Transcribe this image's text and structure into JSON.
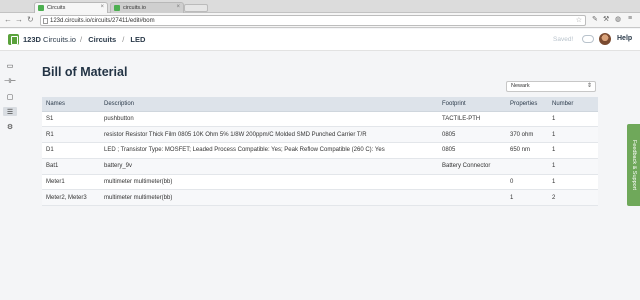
{
  "browser": {
    "tabs": [
      {
        "label": "Circuits",
        "active": true
      },
      {
        "label": "circuits.io",
        "active": false
      }
    ],
    "url": "123d.circuits.io/circuits/27411/edit#bom"
  },
  "header": {
    "brand_bold": "123D",
    "brand_light": "Circuits.io",
    "crumb_separator": "/",
    "crumb_1": "Circuits",
    "crumb_2": "LED",
    "saved_text": "Saved!",
    "help": "Help"
  },
  "main": {
    "title": "Bill of Material",
    "supplier_select": "Newark"
  },
  "table": {
    "headers": {
      "name": "Names",
      "description": "Description",
      "footprint": "Footprint",
      "properties": "Properties",
      "number": "Number"
    },
    "rows": [
      {
        "name": "S1",
        "description": "pushbutton",
        "footprint": "TACTILE-PTH",
        "properties": "",
        "number": "1"
      },
      {
        "name": "R1",
        "description": "resistor Resistor Thick Film 0805 10K Ohm 5% 1/8W 200ppm/C Molded SMD Punched Carrier T/R",
        "footprint": "0805",
        "properties": "370 ohm",
        "number": "1"
      },
      {
        "name": "D1",
        "description": "LED ; Transistor Type: MOSFET; Leaded Process Compatible: Yes; Peak Reflow Compatible (260 C): Yes",
        "footprint": "0805",
        "properties": "650 nm",
        "number": "1"
      },
      {
        "name": "Bat1",
        "description": "battery_9v",
        "footprint": "Battery Connector",
        "properties": "",
        "number": "1"
      },
      {
        "name": "Meter1",
        "description": "multimeter multimeter(bb)",
        "footprint": "",
        "properties": "0",
        "number": "1"
      },
      {
        "name": "Meter2, Meter3",
        "description": "multimeter multimeter(bb)",
        "footprint": "",
        "properties": "1",
        "number": "2"
      }
    ]
  },
  "feedback": "Feedback & Support",
  "colors": {
    "accent": "#5aa23b",
    "title": "#233445",
    "header_bg": "#dde3ea",
    "feedback": "#6fa85a"
  }
}
